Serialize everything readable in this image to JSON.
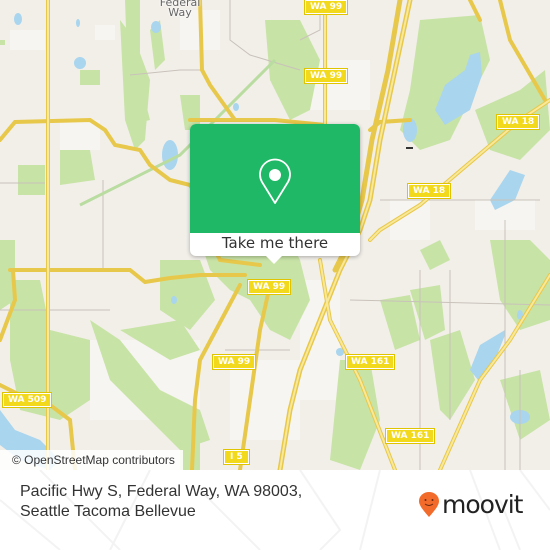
{
  "map": {
    "place_labels": [
      {
        "name": "federal-way",
        "text": "Federal Way"
      }
    ],
    "road_shields": [
      {
        "id": "wa99-top",
        "text": "WA 99"
      },
      {
        "id": "wa99-mid",
        "text": "WA 99"
      },
      {
        "id": "wa18-right",
        "text": "WA 18"
      },
      {
        "id": "wa18-center",
        "text": "WA 18"
      },
      {
        "id": "wa99-center",
        "text": "WA 99"
      },
      {
        "id": "wa99-lower",
        "text": "WA 99"
      },
      {
        "id": "wa161-upper",
        "text": "WA 161"
      },
      {
        "id": "wa509",
        "text": "WA 509"
      },
      {
        "id": "wa161-lower",
        "text": "WA 161"
      },
      {
        "id": "i5",
        "text": "I 5"
      }
    ],
    "attribution": "© OpenStreetMap contributors",
    "colors": {
      "land": "#f2efe9",
      "park": "#c8e3a6",
      "water": "#a9d5ee",
      "road": "#f5dc56",
      "shield": "#f2d91c"
    }
  },
  "popup": {
    "icon": "map-pin-icon",
    "button_label": "Take me there",
    "accent": "#1fb866"
  },
  "footer": {
    "address": "Pacific Hwy S, Federal Way, WA 98003, Seattle Tacoma Bellevue",
    "brand": "moovit",
    "brand_color": "#f26b2b"
  }
}
